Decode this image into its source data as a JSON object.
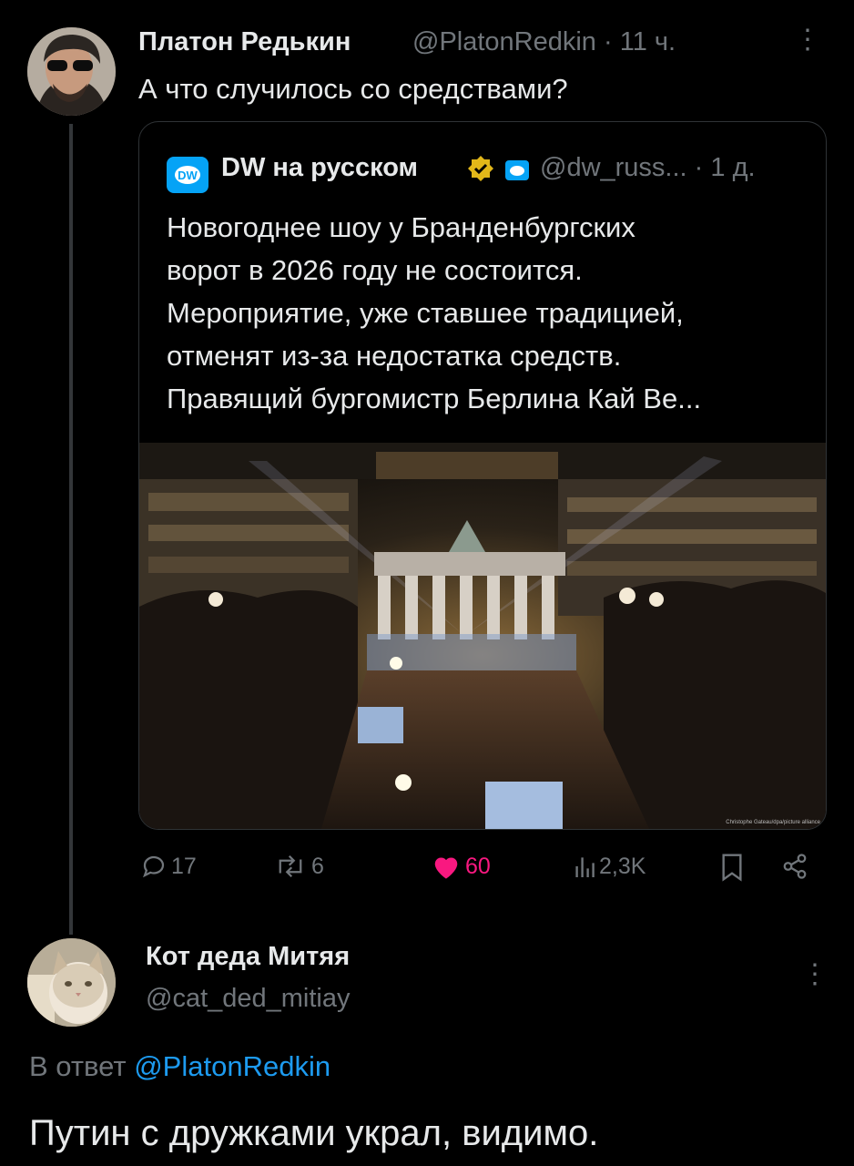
{
  "tweet": {
    "author_name": "Платон Редькин",
    "author_handle": "@PlatonRedkin",
    "time": "· 11 ч.",
    "more_icon": "more-vertical-icon",
    "text": "А что случилось со средствами?"
  },
  "quoted": {
    "author_name": "DW на русском",
    "author_handle": "@dw_russ...",
    "time": "· 1 д.",
    "text_lines": [
      "Новогоднее шоу у Бранденбургских",
      "ворот в 2026 году не состоится.",
      "Мероприятие, уже ставшее традицией,",
      "отменят из-за недостатка средств.",
      "Правящий бургомистр Берлина Кай Ве..."
    ],
    "logo_text": "DW",
    "image_credit": "Christophe Gateau/dpa/picture alliance"
  },
  "actions": {
    "replies": "17",
    "reposts": "6",
    "likes": "60",
    "views": "2,3K"
  },
  "reply": {
    "author_name": "Кот деда Митяя",
    "author_handle": "@cat_ded_mitiay",
    "reply_prefix": "В ответ",
    "reply_to": "@PlatonRedkin",
    "text": "Путин с дружками украл, видимо."
  },
  "colors": {
    "background": "#000000",
    "text": "#e7e9ea",
    "muted": "#71767b",
    "link": "#1d9bf0",
    "like": "#f91880",
    "verified": "#e2b719",
    "dw_blue": "#05a3f6"
  }
}
